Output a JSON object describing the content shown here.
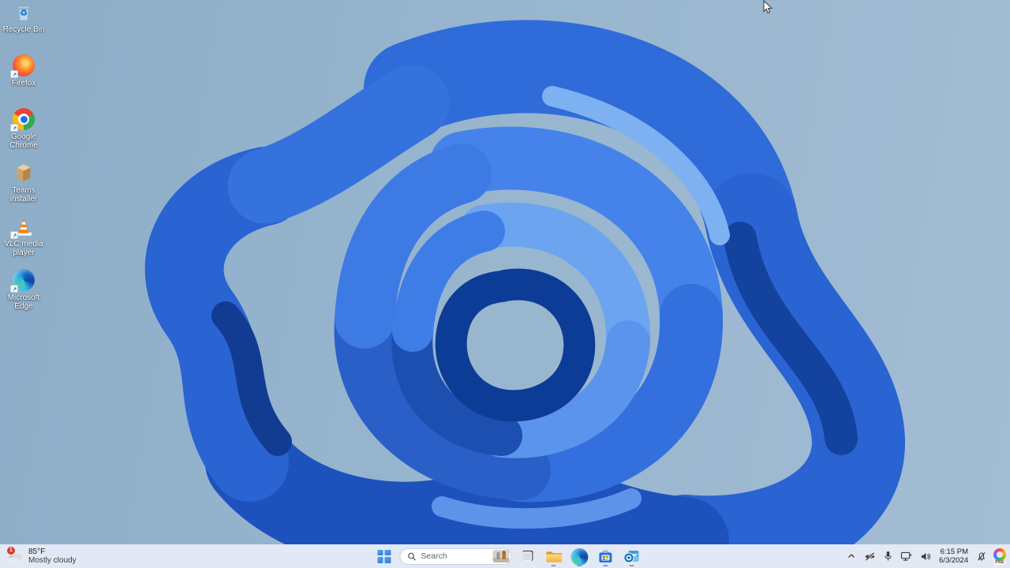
{
  "desktop": {
    "icons": [
      {
        "name": "recycle-bin",
        "label": "Recycle Bin"
      },
      {
        "name": "firefox",
        "label": "Firefox"
      },
      {
        "name": "google-chrome",
        "label": "Google Chrome"
      },
      {
        "name": "teams-installer",
        "label": "Teams installer"
      },
      {
        "name": "vlc-media-player",
        "label": "VLC media player"
      },
      {
        "name": "microsoft-edge",
        "label": "Microsoft Edge"
      }
    ],
    "recycle_glyph": "♻"
  },
  "taskbar": {
    "weather": {
      "badge": "1",
      "temperature": "85°F",
      "condition": "Mostly cloudy"
    },
    "search": {
      "placeholder": "Search"
    },
    "pinned_icons": [
      "start",
      "search",
      "task-view",
      "file-explorer",
      "microsoft-edge",
      "microsoft-store",
      "outlook"
    ],
    "tray_icons": [
      "hidden-icons-chevron",
      "camera-off",
      "microphone",
      "network",
      "volume",
      "notifications-muted-bell",
      "copilot-preview"
    ],
    "clock": {
      "time": "6:15 PM",
      "date": "6/3/2024"
    },
    "copilot_badge": "PRE"
  },
  "colors": {
    "taskbar_bg": "#e2e9f4",
    "wallpaper_base": "#97b5ce",
    "bloom_blue": "#2a63d2",
    "badge_red": "#d83b2a"
  }
}
